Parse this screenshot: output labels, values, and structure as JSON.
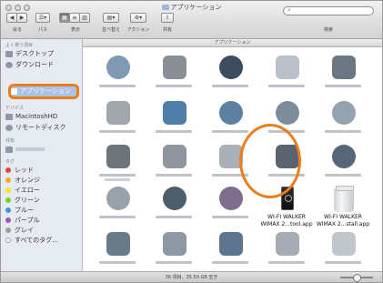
{
  "window": {
    "title": "アプリケーション",
    "path_title": "アプリケーション"
  },
  "toolbar": {
    "back_label": "戻る",
    "path_label": "パス",
    "view_label": "表示",
    "arrange_label": "並べ替え",
    "action_label": "アクション",
    "share_label": "共有",
    "search_label": "検索"
  },
  "sidebar": {
    "favorites_header": "よく使う項目",
    "devices_header": "デバイス",
    "shared_header": "共有",
    "tags_header": "タグ",
    "favorites": [
      {
        "label": "デスクトップ"
      },
      {
        "label": "ダウンロード"
      },
      {
        "label": "アプリケーション"
      }
    ],
    "devices": [
      {
        "label": "MacintoshHD"
      },
      {
        "label": "リモートディスク"
      }
    ],
    "tags": [
      {
        "label": "レッド",
        "color": "#e8443a"
      },
      {
        "label": "オレンジ",
        "color": "#f5a623"
      },
      {
        "label": "イエロー",
        "color": "#f8e71c"
      },
      {
        "label": "グリーン",
        "color": "#7ed321"
      },
      {
        "label": "ブルー",
        "color": "#4a90e2"
      },
      {
        "label": "パープル",
        "color": "#9b59b6"
      },
      {
        "label": "グレイ",
        "color": "#9b9b9b"
      },
      {
        "label": "すべてのタグ..."
      }
    ]
  },
  "content": {
    "apps": [
      {
        "label": "WI-FI WALKER\nWIMAX 2...tool.app"
      },
      {
        "label": "WI-FI WALKER\nWIMAX 2...stall.app"
      }
    ]
  },
  "status": {
    "text": "36 項目、35.50 GB 空き"
  },
  "colors": {
    "highlight": "#ec7d1c",
    "sidebar_bg": "#e6ebf1",
    "selection": "#a8c3e6"
  }
}
